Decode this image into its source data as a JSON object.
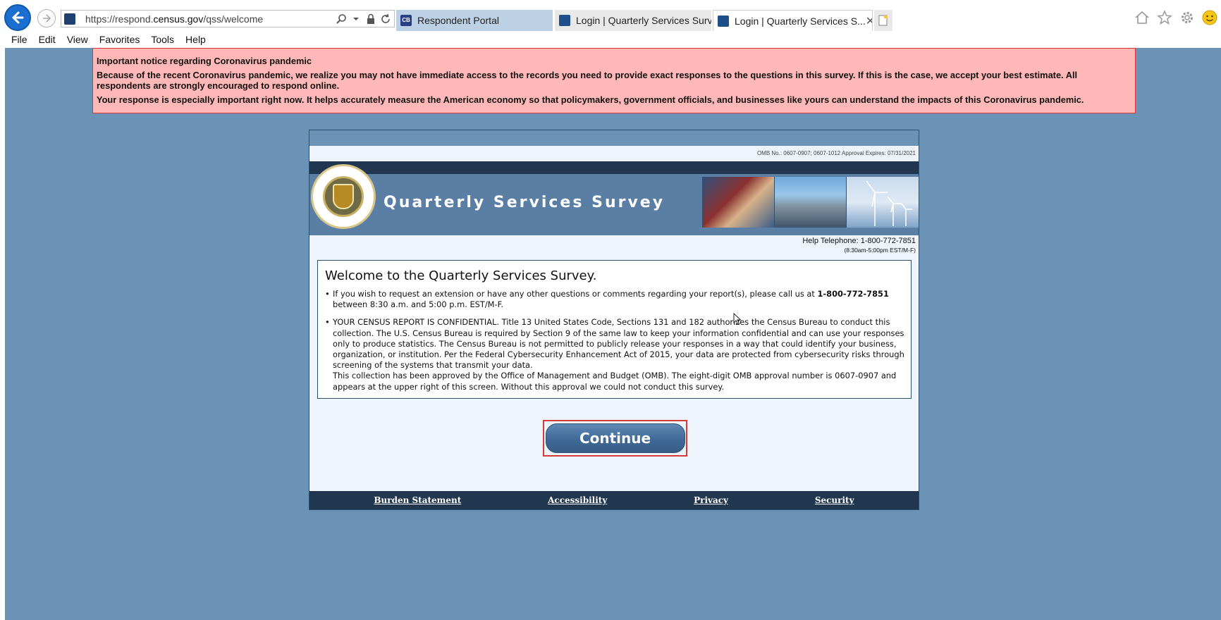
{
  "browser": {
    "url_prefix": "https://respond.",
    "url_domain": "census.gov",
    "url_path": "/qss/welcome",
    "tabs": [
      {
        "label": "Respondent Portal",
        "favicon": "CB",
        "active": false
      },
      {
        "label": "Login | Quarterly Services Surv...",
        "active": false
      },
      {
        "label": "Login | Quarterly Services S...",
        "active": true
      }
    ],
    "tab_close_glyph": "✕",
    "menu": [
      "File",
      "Edit",
      "View",
      "Favorites",
      "Tools",
      "Help"
    ],
    "icons": [
      "back-arrow-icon",
      "forward-arrow-icon",
      "search-icon",
      "dropdown-icon",
      "lock-icon",
      "refresh-icon",
      "new-tab-icon",
      "home-icon",
      "favorites-star-icon",
      "settings-gear-icon",
      "smiley-feedback-icon"
    ]
  },
  "notice": {
    "heading": "Important notice regarding Coronavirus pandemic",
    "para1": "Because of the recent Coronavirus pandemic, we realize you may not have immediate access to the records you need to provide exact responses to the questions in this survey. If this is the case, we accept your best estimate. All respondents are strongly encouraged to respond online.",
    "para2": "Your response is especially important right now. It helps accurately measure the American economy so that policymakers, government officials, and businesses like yours can understand the impacts of this Coronavirus pandemic."
  },
  "header": {
    "omb": "OMB No.: 0607-0907; 0607-1012 Approval Expires: 07/31/2021",
    "title": "Quarterly Services Survey",
    "help_phone": "Help Telephone: 1-800-772-7851",
    "help_hours": "(8:30am-5:00pm EST/M-F)"
  },
  "welcome": {
    "title": "Welcome to the Quarterly Services Survey.",
    "bullet1_pre": "If you wish to request an extension or have any other questions or comments regarding your report(s), please call us at ",
    "bullet1_phone": "1-800-772-7851",
    "bullet1_post": " between 8:30 a.m. and 5:00 p.m. EST/M-F.",
    "bullet2_a": "YOUR CENSUS REPORT IS CONFIDENTIAL. Title 13 United States Code, Sections 131 and 182 authorizes the Census Bureau to conduct this collection. The U.S. Census Bureau is required by Section 9 of the same law to keep your information confidential and can use your responses only to produce statistics. The Census Bureau is not permitted to publicly release your responses in a way that could identify your business, organization, or institution. Per the Federal Cybersecurity Enhancement Act of 2015, your data are protected from cybersecurity risks through screening of the systems that transmit your data.",
    "bullet2_b": "This collection has been approved by the Office of Management and Budget (OMB). The eight-digit OMB approval number is 0607-0907 and appears at the upper right of this screen. Without this approval we could not conduct this survey."
  },
  "continue_label": "Continue",
  "footer": [
    "Burden Statement",
    "Accessibility",
    "Privacy",
    "Security"
  ],
  "colors": {
    "page_bg": "#6a93b5",
    "notice_bg": "#ffb7b7",
    "notice_border": "#d93636",
    "banner_dark": "#21374f",
    "button_highlight": "#d83a3a"
  }
}
